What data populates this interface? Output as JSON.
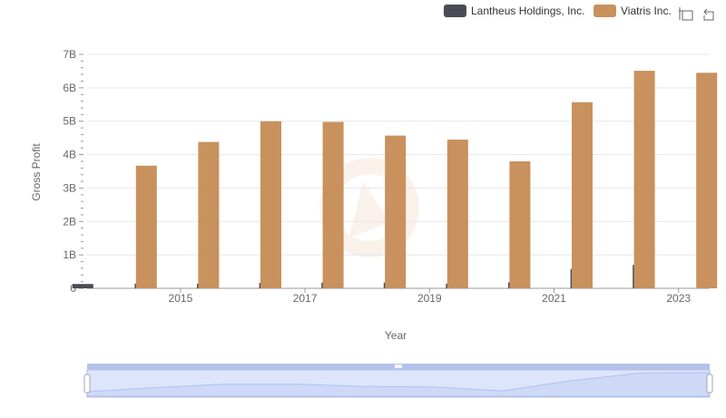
{
  "colors": {
    "series_1": "#4b4b55",
    "series_2": "#c8915d",
    "grid": "#e6e6ee",
    "zoom_fill": "#dde5fb",
    "zoom_border": "#b4c2ea"
  },
  "toolbar": {
    "zoom_icon": "zoom-select-icon",
    "reset_icon": "zoom-reset-icon"
  },
  "chart_data": {
    "type": "bar",
    "categories": [
      "2014",
      "2015",
      "2016",
      "2017",
      "2018",
      "2019",
      "2020",
      "2021",
      "2022",
      "2023"
    ],
    "series": [
      {
        "name": "Lantheus Holdings, Inc.",
        "values": [
          0.13,
          0.14,
          0.14,
          0.16,
          0.17,
          0.17,
          0.14,
          0.18,
          0.58,
          0.7
        ]
      },
      {
        "name": "Viatris Inc.",
        "values": [
          3.67,
          4.38,
          5.0,
          4.98,
          4.57,
          4.45,
          3.8,
          5.57,
          6.51,
          6.45
        ]
      }
    ],
    "x_tick_labels": [
      "2015",
      "2017",
      "2019",
      "2021",
      "2023"
    ],
    "y_ticks": [
      {
        "value": 0,
        "label": "0"
      },
      {
        "value": 1,
        "label": "1B"
      },
      {
        "value": 2,
        "label": "2B"
      },
      {
        "value": 3,
        "label": "3B"
      },
      {
        "value": 4,
        "label": "4B"
      },
      {
        "value": 5,
        "label": "5B"
      },
      {
        "value": 6,
        "label": "6B"
      },
      {
        "value": 7,
        "label": "7B"
      }
    ],
    "ylim": [
      0,
      7
    ],
    "xlabel": "Year",
    "ylabel": "Gross Profit",
    "grid": true,
    "legend_position": "top-right",
    "zoom_slider": true
  }
}
